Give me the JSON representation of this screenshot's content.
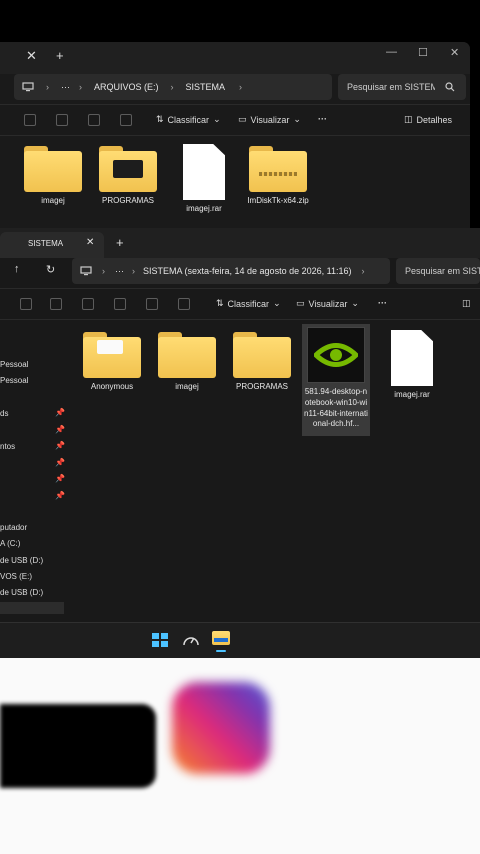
{
  "window_back": {
    "tab_close": "✕",
    "tab_add": "+",
    "caption_buttons": [
      "—",
      "☐",
      "✕"
    ],
    "breadcrumb": {
      "more": "···",
      "items": [
        "ARQUIVOS (E:)",
        "SISTEMA"
      ]
    },
    "search": {
      "placeholder": "Pesquisar em SISTEMA"
    },
    "toolbar": {
      "sort": "Classificar",
      "view": "Visualizar",
      "more": "···",
      "details": "Detalhes"
    },
    "files": [
      {
        "name": "imagej",
        "kind": "folder"
      },
      {
        "name": "PROGRAMAS",
        "kind": "folder"
      },
      {
        "name": "imagej.rar",
        "kind": "document"
      },
      {
        "name": "ImDiskTk-x64.zip",
        "kind": "zip"
      }
    ]
  },
  "window_front": {
    "tab_title": "SISTEMA",
    "tab_close": "✕",
    "tab_add": "+",
    "breadcrumb": {
      "more": "···",
      "current": "SISTEMA (sexta-feira, 14 de agosto de 2026, 11:16)"
    },
    "search": {
      "placeholder": "Pesquisar em SISTEMA"
    },
    "toolbar": {
      "sort": "Classificar",
      "view": "Visualizar",
      "more": "···"
    },
    "sidebar": [
      {
        "label": "Pessoal"
      },
      {
        "label": "Pessoal"
      },
      {
        "label": "ds",
        "pinned": true
      },
      {
        "label": "ntos",
        "pinned": true
      },
      {
        "label": "",
        "pinned": true
      },
      {
        "label": "",
        "pinned": true
      },
      {
        "label": "",
        "pinned": true
      },
      {
        "label": "putador"
      },
      {
        "label": "A (C:)"
      },
      {
        "label": "de USB (D:)"
      },
      {
        "label": "VOS (E:)"
      },
      {
        "label": "de USB (D:)"
      }
    ],
    "files": [
      {
        "name": "Anonymous",
        "kind": "folder"
      },
      {
        "name": "imagej",
        "kind": "folder"
      },
      {
        "name": "PROGRAMAS",
        "kind": "folder"
      },
      {
        "name": "581.94-desktop-notebook-win10-win11-64bit-international-dch.hf...",
        "kind": "nvidia-installer"
      },
      {
        "name": "imagej.rar",
        "kind": "document"
      }
    ]
  },
  "taskbar": {
    "icons": [
      "start-icon",
      "gauge-icon",
      "file-explorer-icon"
    ]
  },
  "colors": {
    "accent": "#4cc2ff",
    "nvidia_green": "#76b900",
    "folder": "#f6cc5c"
  }
}
